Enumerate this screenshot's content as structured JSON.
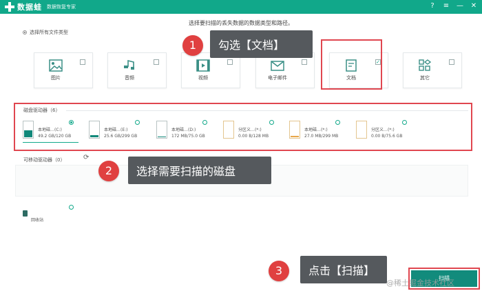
{
  "titlebar": {
    "app_name": "数据蛙",
    "subtitle": "数据恢复专家",
    "help": "?",
    "menu": "≡",
    "minimize": "—",
    "close": "✕"
  },
  "heading": "选择要扫描的丢失数据的数据类型和路径。",
  "select_all": "选择所有文件类型",
  "file_types": [
    {
      "label": "图片",
      "checked": false
    },
    {
      "label": "音频",
      "checked": false
    },
    {
      "label": "视频",
      "checked": false
    },
    {
      "label": "电子邮件",
      "checked": false
    },
    {
      "label": "文档",
      "checked": true
    },
    {
      "label": "其它",
      "checked": false
    }
  ],
  "disk_section": {
    "title": "磁盘驱动器（6）",
    "drives": [
      {
        "name": "本地磁…(C:)",
        "size": "49.2 GB/120 GB",
        "selected": true
      },
      {
        "name": "本地磁…(E:)",
        "size": "25.6 GB/299 GB",
        "selected": false
      },
      {
        "name": "本地磁…(D:)",
        "size": "172 MB/75.0 GB",
        "selected": false
      },
      {
        "name": "分区义…(*:)",
        "size": "0.00 B/128 MB",
        "selected": false
      },
      {
        "name": "本地磁…(*:)",
        "size": "27.0 MB/299 MB",
        "selected": false
      },
      {
        "name": "分区义…(*:)",
        "size": "0.00 B/75.6 GB",
        "selected": false
      }
    ]
  },
  "removable_section": {
    "title": "可移动驱动器（0）"
  },
  "recycle_bin_label": "回收站",
  "scan_button": "扫描",
  "annotations": [
    {
      "number": "1",
      "text": "勾选【文档】"
    },
    {
      "number": "2",
      "text": "选择需要扫描的磁盘"
    },
    {
      "number": "3",
      "text": "点击【扫描】"
    }
  ],
  "watermark": "@稀土掘金技术社区",
  "colors": {
    "brand": "#11a88a",
    "highlight": "#e0464f",
    "callout_bg": "#55595d",
    "badge": "#e04040",
    "scan_button": "#128b7c"
  }
}
